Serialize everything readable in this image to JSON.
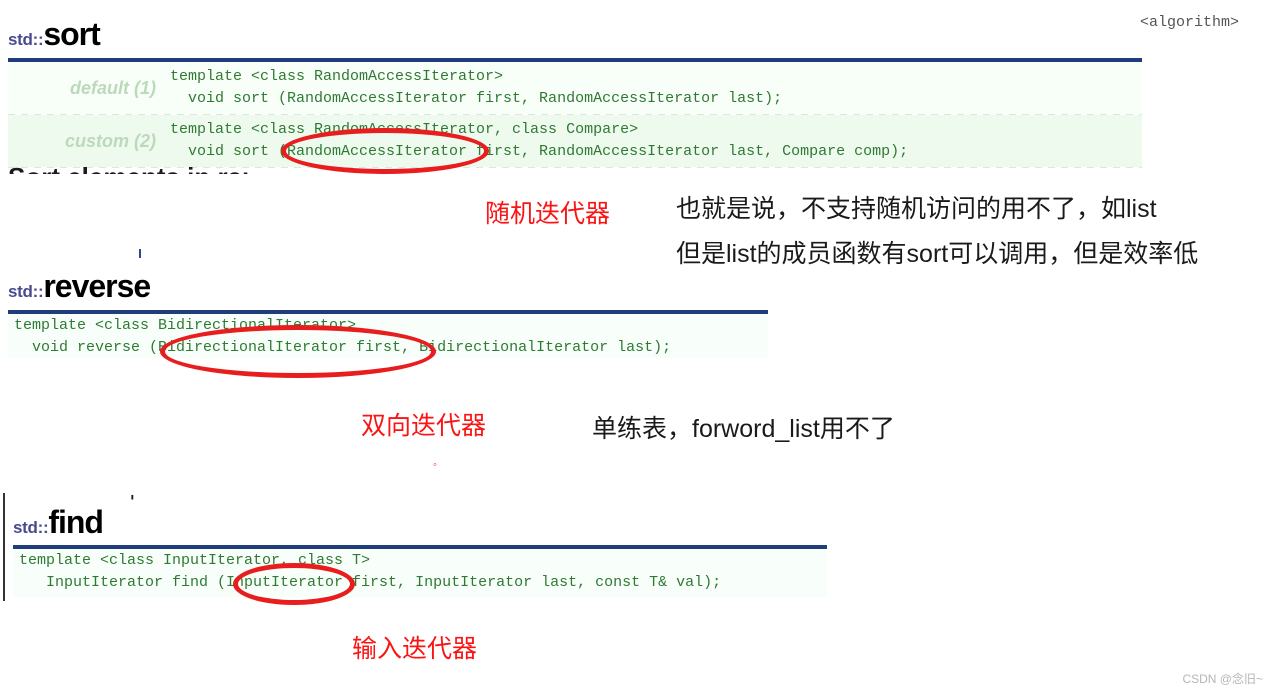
{
  "page": {
    "watermark": "CSDN @念旧~",
    "header_include": "<algorithm>",
    "colors": {
      "heading_namespace": "#4a4a8f",
      "heading_function": "#000000",
      "rule": "#1f3d7a",
      "code_text": "#2f7a32",
      "code_bg_light": "#f8fff8",
      "code_bg_dark": "#effaef",
      "annotation_red": "#fa1414",
      "annotation_black": "#1a1a1a",
      "ellipse": "#e81d1d",
      "label_green": "#bcd9bc"
    }
  },
  "sections": [
    {
      "id": "sort",
      "namespace": "std::",
      "function": "sort",
      "prototypes": [
        {
          "label": "default (1)",
          "line1": "template <class RandomAccessIterator>",
          "line2": "  void sort (RandomAccessIterator first, RandomAccessIterator last);"
        },
        {
          "label": "custom (2)",
          "line1": "template <class RandomAccessIterator, class Compare>",
          "line2": "  void sort (RandomAccessIterator first, RandomAccessIterator last, Compare comp);"
        }
      ],
      "clipped_subheading": "Sort elements in range",
      "annotation_red": "随机迭代器",
      "annotation_black": [
        "也就是说，不支持随机访问的用不了，如list",
        "但是list的成员函数有sort可以调用，但是效率低"
      ],
      "circled_term": "RandomAccessIterator"
    },
    {
      "id": "reverse",
      "namespace": "std::",
      "function": "reverse",
      "code": "template <class BidirectionalIterator>\n  void reverse (BidirectionalIterator first, BidirectionalIterator last);",
      "annotation_red": "双向迭代器",
      "annotation_black": [
        "单练表，forword_list用不了"
      ],
      "circled_term": "BidirectionalIterator"
    },
    {
      "id": "find",
      "namespace": "std::",
      "function": "find",
      "code": "template <class InputIterator, class T>\n   InputIterator find (InputIterator first, InputIterator last, const T& val);",
      "annotation_red": "输入迭代器",
      "annotation_black": [],
      "circled_term": "InputIterator"
    }
  ]
}
